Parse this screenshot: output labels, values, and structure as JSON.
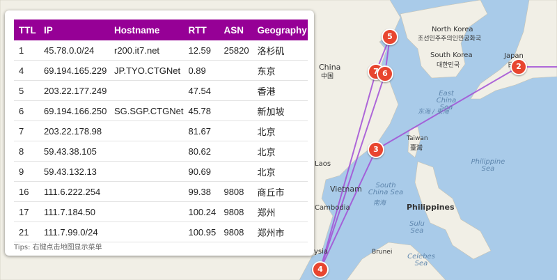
{
  "table": {
    "headers": [
      "TTL",
      "IP",
      "Hostname",
      "RTT",
      "ASN",
      "Geography"
    ],
    "rows": [
      {
        "ttl": "1",
        "ip": "45.78.0.0/24",
        "hostname": "r200.it7.net",
        "rtt": "12.59",
        "asn": "25820",
        "geo": "洛杉矶"
      },
      {
        "ttl": "4",
        "ip": "69.194.165.229",
        "hostname": "JP.TYO.CTGNet",
        "rtt": "0.89",
        "asn": "",
        "geo": "东京"
      },
      {
        "ttl": "5",
        "ip": "203.22.177.249",
        "hostname": "",
        "rtt": "47.54",
        "asn": "",
        "geo": "香港"
      },
      {
        "ttl": "6",
        "ip": "69.194.166.250",
        "hostname": "SG.SGP.CTGNet",
        "rtt": "45.78",
        "asn": "",
        "geo": "新加坡"
      },
      {
        "ttl": "7",
        "ip": "203.22.178.98",
        "hostname": "",
        "rtt": "81.67",
        "asn": "",
        "geo": "北京"
      },
      {
        "ttl": "8",
        "ip": "59.43.38.105",
        "hostname": "",
        "rtt": "80.62",
        "asn": "",
        "geo": "北京"
      },
      {
        "ttl": "9",
        "ip": "59.43.132.13",
        "hostname": "",
        "rtt": "90.69",
        "asn": "",
        "geo": "北京"
      },
      {
        "ttl": "16",
        "ip": "111.6.222.254",
        "hostname": "",
        "rtt": "99.38",
        "asn": "9808",
        "geo": "商丘市"
      },
      {
        "ttl": "17",
        "ip": "111.7.184.50",
        "hostname": "",
        "rtt": "100.24",
        "asn": "9808",
        "geo": "郑州"
      },
      {
        "ttl": "21",
        "ip": "111.7.99.0/24",
        "hostname": "",
        "rtt": "100.95",
        "asn": "9808",
        "geo": "郑州市"
      }
    ]
  },
  "tips": "Tips: 右键点击地图显示菜单",
  "map": {
    "labels": {
      "north_korea": "North Korea",
      "north_korea_local": "조선민주주의인민공화국",
      "south_korea": "South Korea",
      "south_korea_local": "대한민국",
      "japan": "Japan",
      "japan_local": "日本",
      "china": "China",
      "china_local": "中国",
      "east_china_sea": "East China Sea",
      "east_china_sea_local": "东海 / 東海",
      "taiwan": "Taiwan",
      "taiwan_local": "臺灣",
      "laos": "Laos",
      "vietnam": "Vietnam",
      "cambodia": "Cambodia",
      "philippine_sea": "Philippine Sea",
      "south_china_sea": "South China Sea",
      "south_china_sea_local": "南海",
      "philippines": "Philippines",
      "sulu_sea": "Sulu Sea",
      "brunei": "Brunei",
      "celebes_sea": "Celebes Sea",
      "malaysia_fragment": "ysia"
    },
    "markers": [
      "5",
      "7",
      "6",
      "2",
      "3",
      "4"
    ],
    "colors": {
      "route": "#a24fd6",
      "marker": "#e8452f",
      "header": "#960096",
      "land": "#f1efe6",
      "water": "#a9cbe9"
    }
  }
}
